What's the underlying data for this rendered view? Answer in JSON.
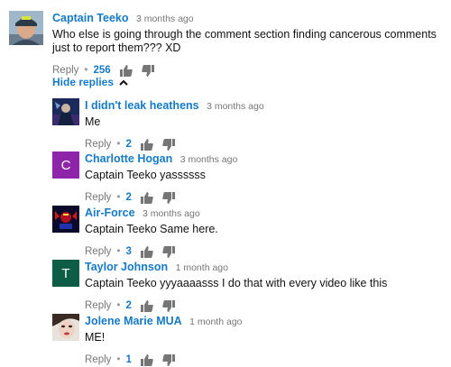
{
  "colors": {
    "link": "#167ac6",
    "meta": "#767676",
    "text": "#111111"
  },
  "top_comment": {
    "author": "Captain Teeko",
    "time": "3 months ago",
    "text": "Who else is going through the comment section finding cancerous comments just to report them??? XD",
    "reply_label": "Reply",
    "separator": "•",
    "likes": "256"
  },
  "hide_replies": {
    "label": "Hide replies",
    "icon": "chevron-up-icon"
  },
  "replies": [
    {
      "author": "I didn't leak heathens",
      "time": "3 months ago",
      "text": "Me",
      "reply_label": "Reply",
      "separator": "•",
      "likes": "2"
    },
    {
      "author": "Charlotte Hogan",
      "time": "3 months ago",
      "text": "Captain Teeko yassssss",
      "reply_label": "Reply",
      "separator": "•",
      "likes": "2",
      "avatar_letter": "C",
      "avatar_color": "#8e24aa"
    },
    {
      "author": "Air-Force",
      "time": "3 months ago",
      "text": "Captain Teeko Same here.",
      "reply_label": "Reply",
      "separator": "•",
      "likes": "3"
    },
    {
      "author": "Taylor Johnson",
      "time": "1 month ago",
      "text": "Captain Teeko yyyaaaasss I do that with every video like this",
      "reply_label": "Reply",
      "separator": "•",
      "likes": "2",
      "avatar_letter": "T",
      "avatar_color": "#0d5c45"
    },
    {
      "author": "Jolene Marie MUA",
      "time": "1 month ago",
      "text": "ME!",
      "reply_label": "Reply",
      "separator": "•",
      "likes": "1"
    }
  ]
}
